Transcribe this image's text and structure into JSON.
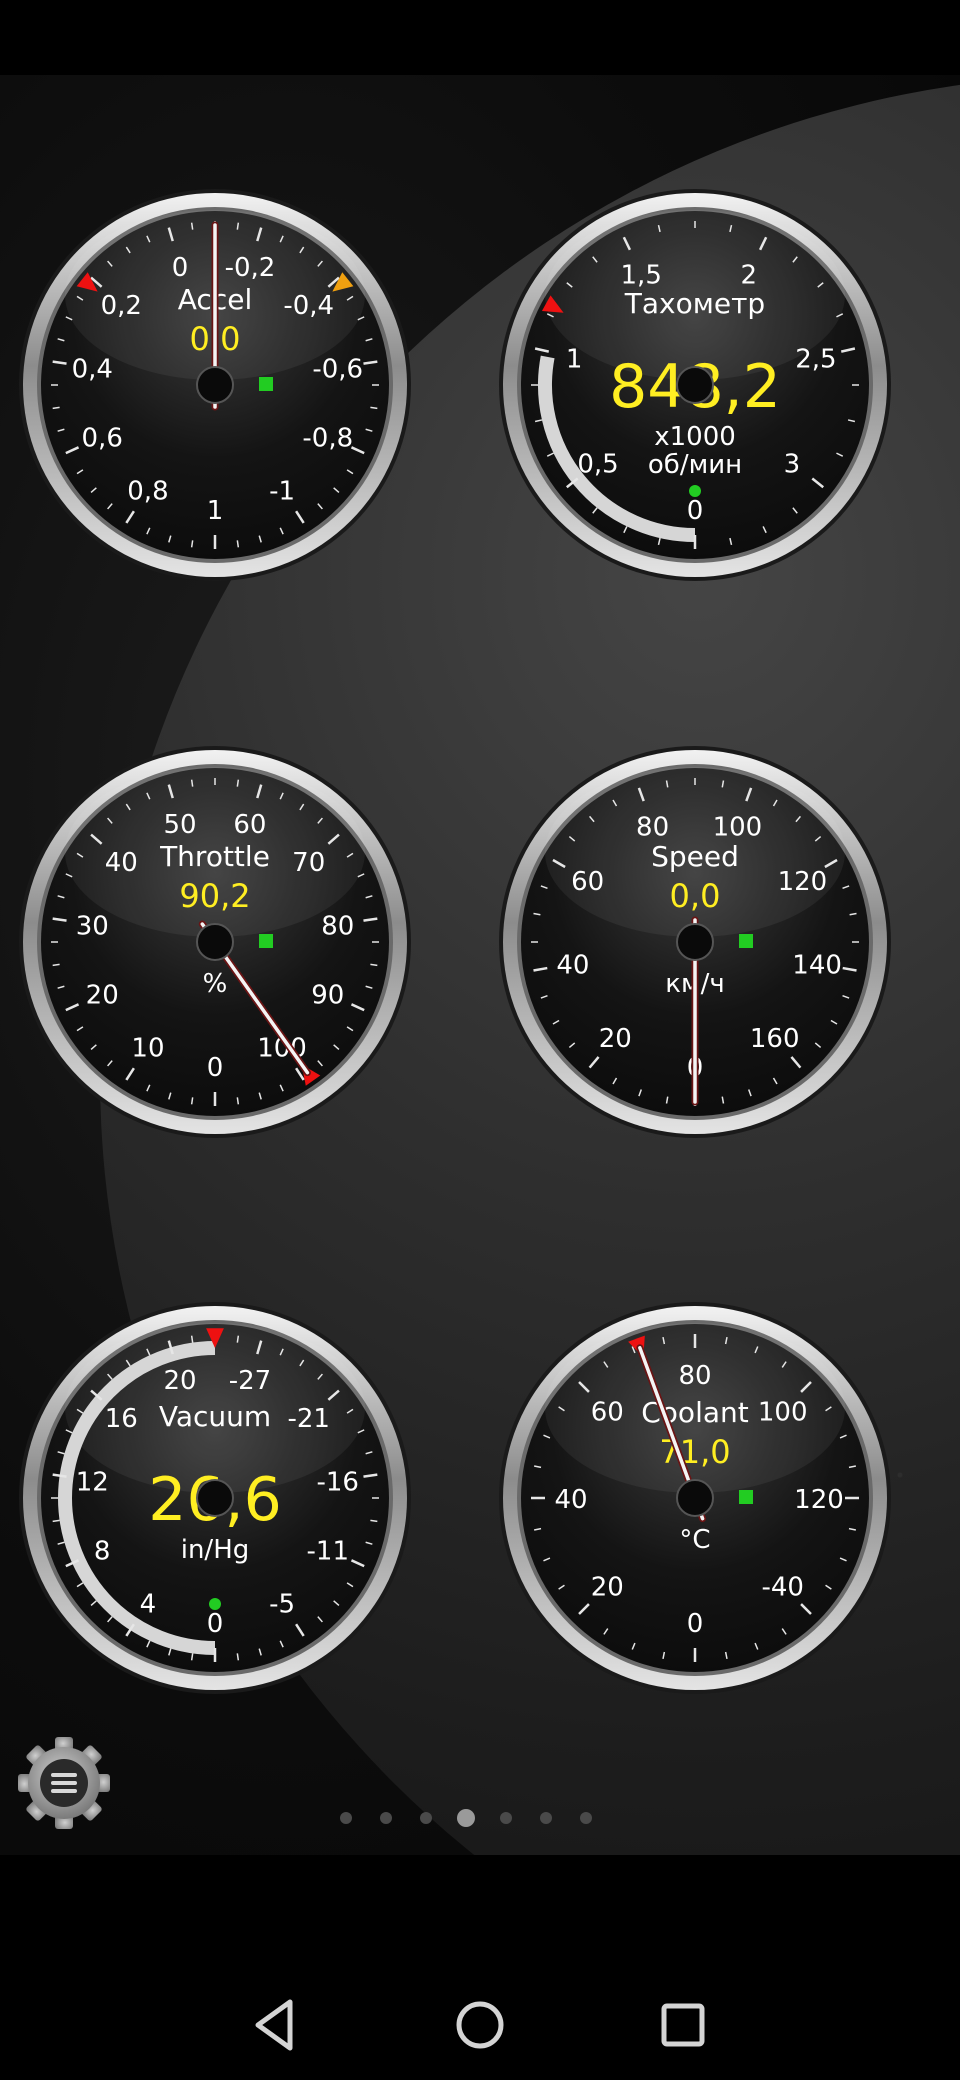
{
  "dashboard": {
    "gauges": [
      {
        "id": "accel",
        "title": "Accel",
        "value": "0,0",
        "unit": "",
        "unit2": "",
        "ticks": [
          "1",
          "0,8",
          "0,6",
          "0,4",
          "0,2",
          "0",
          "-0,2",
          "-0,4",
          "-0,6",
          "-0,8",
          "-1"
        ],
        "value_fraction": 0.5,
        "big_value": false,
        "max_marker_fraction": 0.357,
        "min_marker_fraction": 0.643,
        "arc_fraction": 0
      },
      {
        "id": "tachometer",
        "title": "Тахометр",
        "value": "848,2",
        "unit": "x1000",
        "unit2": "об/мин",
        "ticks": [
          "0",
          "0,5",
          "1",
          "1,5",
          "2",
          "2,5",
          "3"
        ],
        "value_fraction": 0.28,
        "big_value": true,
        "max_marker_fraction": 0.33,
        "min_marker_fraction": null,
        "arc_fraction": 0.28
      },
      {
        "id": "throttle",
        "title": "Throttle",
        "value": "90,2",
        "unit": "%",
        "unit2": "",
        "ticks": [
          "0",
          "10",
          "20",
          "30",
          "40",
          "50",
          "60",
          "70",
          "80",
          "90",
          "100"
        ],
        "value_fraction": 0.902,
        "big_value": false,
        "max_marker_fraction": 0.902,
        "min_marker_fraction": null,
        "arc_fraction": 0
      },
      {
        "id": "speed",
        "title": "Speed",
        "value": "0,0",
        "unit": "км/ч",
        "unit2": "",
        "ticks": [
          "0",
          "20",
          "40",
          "60",
          "80",
          "100",
          "120",
          "140",
          "160"
        ],
        "value_fraction": 0,
        "big_value": false,
        "max_marker_fraction": null,
        "min_marker_fraction": null,
        "arc_fraction": 0
      },
      {
        "id": "vacuum",
        "title": "Vacuum",
        "value": "26,6",
        "unit": "in/Hg",
        "unit2": "",
        "ticks": [
          "0",
          "4",
          "8",
          "12",
          "16",
          "20",
          "-27",
          "-21",
          "-16",
          "-11",
          "-5"
        ],
        "value_fraction": 0.5,
        "big_value": true,
        "max_marker_fraction": 0.5,
        "min_marker_fraction": null,
        "arc_fraction": 0.5
      },
      {
        "id": "coolant",
        "title": "Coolant",
        "value": "71,0",
        "unit": "°C",
        "unit2": "",
        "ticks": [
          "0",
          "20",
          "40",
          "60",
          "80",
          "100",
          "120",
          "-40"
        ],
        "value_fraction": 0.444,
        "big_value": false,
        "max_marker_fraction": 0.444,
        "min_marker_fraction": null,
        "arc_fraction": 0
      }
    ]
  },
  "pager": {
    "page_count": 7,
    "active_page": 4
  },
  "colors": {
    "value_yellow": "#ffee22",
    "label_white": "#ffffff",
    "face_dark": "#0b0b0b",
    "bezel_silver": "#c8c8c8",
    "marker_red": "#ee1111",
    "marker_orange": "#f0a010",
    "indicator_green": "#22cc22",
    "needle_white": "#f4f4f4"
  },
  "icons": {
    "settings": "gear-menu-icon",
    "back": "back-triangle-icon",
    "home": "home-circle-icon",
    "recents": "recents-square-icon"
  }
}
